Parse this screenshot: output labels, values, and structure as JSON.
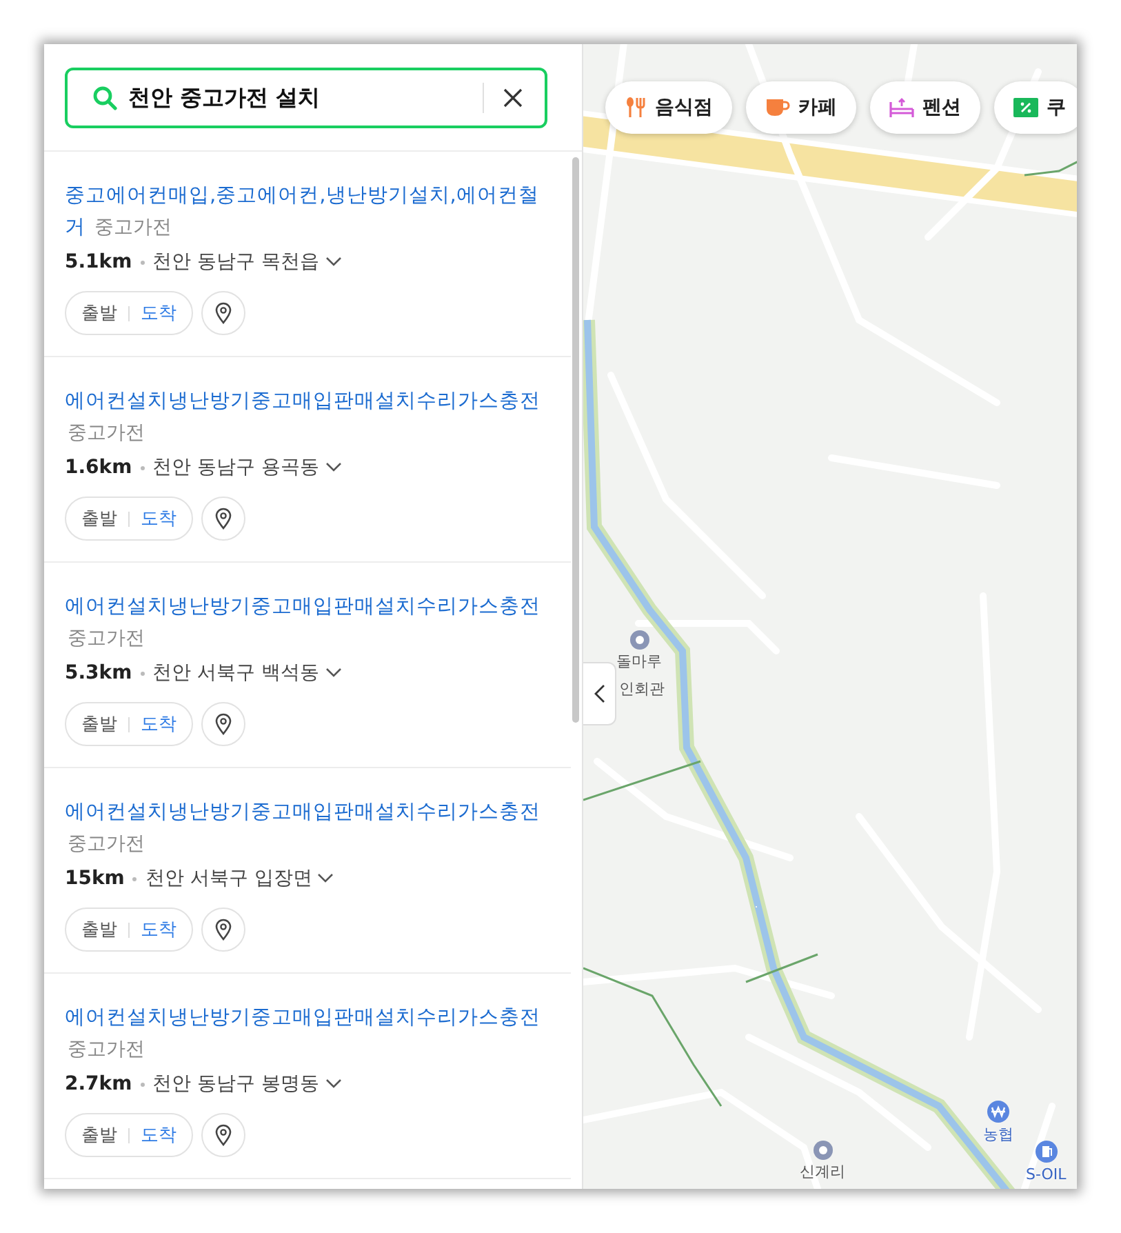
{
  "search": {
    "value": "천안 중고가전 설치"
  },
  "results": [
    {
      "title": "중고에어컨매입,중고에어컨,냉난방기설치,에어컨철거",
      "category": "중고가전",
      "distance": "5.1km",
      "address": "천안 동남구 목천읍",
      "start": "출발",
      "arrive": "도착"
    },
    {
      "title": "에어컨설치냉난방기중고매입판매설치수리가스충전",
      "category": "중고가전",
      "distance": "1.6km",
      "address": "천안 동남구 용곡동",
      "start": "출발",
      "arrive": "도착"
    },
    {
      "title": "에어컨설치냉난방기중고매입판매설치수리가스충전",
      "category": "중고가전",
      "distance": "5.3km",
      "address": "천안 서북구 백석동",
      "start": "출발",
      "arrive": "도착"
    },
    {
      "title": "에어컨설치냉난방기중고매입판매설치수리가스충전",
      "category": "중고가전",
      "distance": "15km",
      "address": "천안 서북구 입장면",
      "start": "출발",
      "arrive": "도착"
    },
    {
      "title": "에어컨설치냉난방기중고매입판매설치수리가스충전",
      "category": "중고가전",
      "distance": "2.7km",
      "address": "천안 동남구 봉명동",
      "start": "출발",
      "arrive": "도착"
    }
  ],
  "categories": [
    {
      "label": "음식점",
      "kind": "restaurant"
    },
    {
      "label": "카페",
      "kind": "cafe"
    },
    {
      "label": "펜션",
      "kind": "pension"
    },
    {
      "label": "쿠",
      "kind": "coupon"
    }
  ],
  "map_labels": [
    {
      "text": "돌마루",
      "kind": "place"
    },
    {
      "text": "인회관",
      "kind": "plain"
    },
    {
      "text": "농협",
      "kind": "bank"
    },
    {
      "text": "신계리",
      "kind": "place"
    },
    {
      "text": "S-OIL",
      "kind": "gas"
    }
  ]
}
